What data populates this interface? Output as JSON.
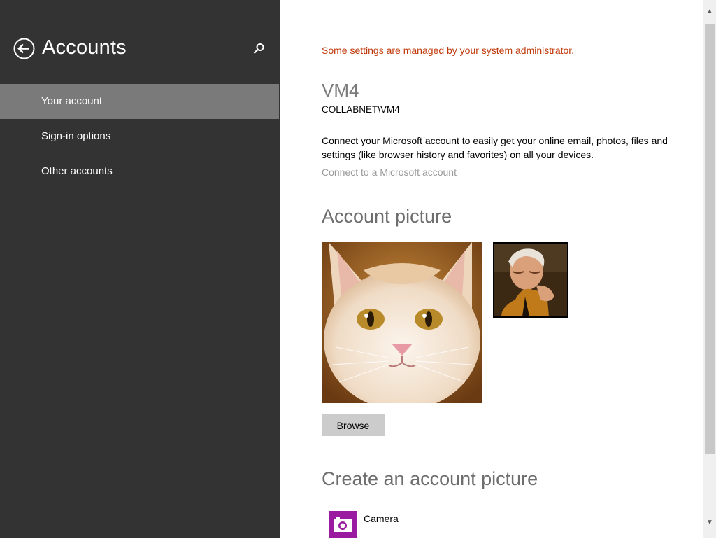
{
  "sidebar": {
    "back_icon": "back-arrow-icon",
    "title": "Accounts",
    "search_icon": "search-icon",
    "items": [
      {
        "label": "Your account",
        "selected": true
      },
      {
        "label": "Sign-in options",
        "selected": false
      },
      {
        "label": "Other accounts",
        "selected": false
      }
    ]
  },
  "main": {
    "admin_notice": "Some settings are managed by your system administrator.",
    "user": {
      "name": "VM4",
      "domain_account": "COLLABNET\\VM4"
    },
    "connect": {
      "description": "Connect your Microsoft account to easily get your online email, photos, files and settings (like browser history and favorites) on all your devices.",
      "link": "Connect to a Microsoft account"
    },
    "account_picture": {
      "title": "Account picture",
      "browse_label": "Browse"
    },
    "create_picture": {
      "title": "Create an account picture",
      "apps": [
        {
          "label": "Camera",
          "icon": "camera-icon",
          "tile_color": "#9a1aa0"
        }
      ]
    }
  },
  "colors": {
    "sidebar_bg": "#333333",
    "selected_item_bg": "#7a7a7a",
    "admin_notice": "#c0390b",
    "link_gray": "#9a9a9a"
  }
}
